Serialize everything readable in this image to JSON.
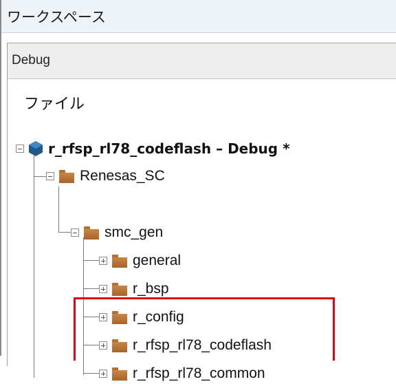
{
  "window": {
    "title": "ワークスペース"
  },
  "combo": {
    "value": "Debug"
  },
  "tree": {
    "header": "ファイル",
    "project": {
      "label": "r_rfsp_rl78_codeflash – Debug *",
      "icon": "project-hexagon-icon"
    },
    "renesas_sc": {
      "label": "Renesas_SC",
      "icon": "folder-icon"
    },
    "smc_gen": {
      "label": "smc_gen",
      "icon": "folder-icon"
    },
    "children": [
      {
        "label": "general"
      },
      {
        "label": "r_bsp"
      },
      {
        "label": "r_config"
      },
      {
        "label": "r_rfsp_rl78_codeflash"
      },
      {
        "label": "r_rfsp_rl78_common"
      }
    ]
  },
  "colors": {
    "highlight": "#e60012",
    "folder": "#b5702f",
    "project_icon": "#1f5a8a"
  }
}
